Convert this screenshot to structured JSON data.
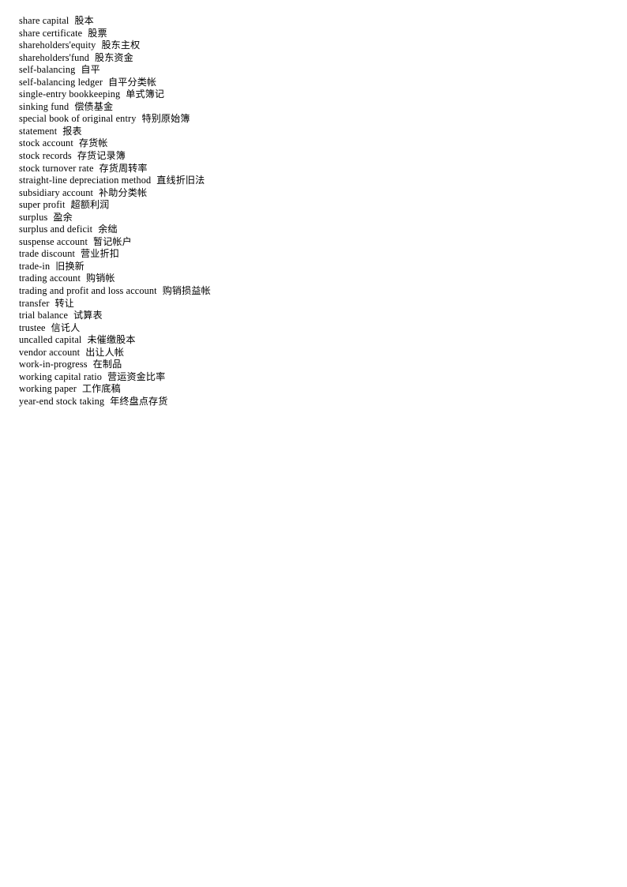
{
  "document": {
    "type": "bilingual-glossary",
    "subject": "accounting terminology",
    "language_pair": "English-Chinese",
    "entry_count": 31,
    "page_background": "#ffffff",
    "text_color": "#000000"
  },
  "entries": [
    {
      "term": "share capital",
      "gloss": "股本"
    },
    {
      "term": "share certificate",
      "gloss": "股票"
    },
    {
      "term": "shareholders'equity",
      "gloss": "股东主权"
    },
    {
      "term": "shareholders'fund",
      "gloss": "股东资金"
    },
    {
      "term": "self-balancing",
      "gloss": "自平"
    },
    {
      "term": "self-balancing  ledger",
      "gloss": "自平分类帐"
    },
    {
      "term": "single-entry bookkeeping",
      "gloss": "单式簿记"
    },
    {
      "term": "sinking fund",
      "gloss": "偿债基金"
    },
    {
      "term": "special book of original  entry",
      "gloss": "特别原始簿"
    },
    {
      "term": "statement",
      "gloss": "报表"
    },
    {
      "term": "stock account",
      "gloss": "存货帐"
    },
    {
      "term": "stock records",
      "gloss": "存货记录簿"
    },
    {
      "term": "stock turnover rate",
      "gloss": "存货周转率"
    },
    {
      "term": "straight-line  depreciation  method",
      "gloss": "直线折旧法"
    },
    {
      "term": "subsidiary account",
      "gloss": "补助分类帐"
    },
    {
      "term": "super profit",
      "gloss": "超额利润"
    },
    {
      "term": "surplus",
      "gloss": "盈余"
    },
    {
      "term": "surplus and deficit",
      "gloss": "余绌"
    },
    {
      "term": "suspense account",
      "gloss": "暂记帐户"
    },
    {
      "term": "trade  discount",
      "gloss": "营业折扣"
    },
    {
      "term": "trade-in",
      "gloss": "旧换新"
    },
    {
      "term": "trading  account",
      "gloss": "购销帐"
    },
    {
      "term": "trading  and profit and loss account",
      "gloss": "购销损益帐"
    },
    {
      "term": "transfer",
      "gloss": "转让"
    },
    {
      "term": "trial balance",
      "gloss": "试算表"
    },
    {
      "term": "trustee",
      "gloss": "信讬人"
    },
    {
      "term": "uncalled  capital",
      "gloss": "未催缴股本"
    },
    {
      "term": "vendor account",
      "gloss": "出让人帐"
    },
    {
      "term": "work-in-progress",
      "gloss": "在制品"
    },
    {
      "term": "working capital  ratio",
      "gloss": "营运资金比率"
    },
    {
      "term": "working paper",
      "gloss": "工作底稿"
    },
    {
      "term": "year-end stock taking",
      "gloss": "年终盘点存货"
    }
  ]
}
